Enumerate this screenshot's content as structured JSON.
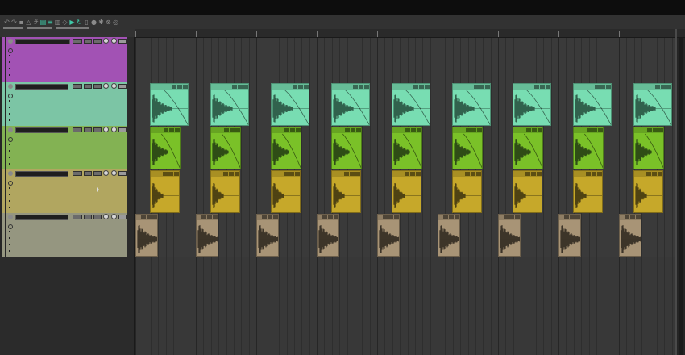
{
  "toolbar": {
    "buttons": [
      {
        "name": "undo-icon",
        "glyph": "↶",
        "hl": false
      },
      {
        "name": "redo-icon",
        "glyph": "↷",
        "hl": false
      },
      {
        "name": "save-icon",
        "glyph": "▪",
        "hl": false
      },
      {
        "name": "metronome-icon",
        "glyph": "△",
        "hl": false
      },
      {
        "name": "grid-icon",
        "glyph": "#",
        "hl": false
      },
      {
        "name": "snap-icon",
        "glyph": "▤",
        "hl": true
      },
      {
        "name": "ripple-icon",
        "glyph": "≡",
        "hl": true
      },
      {
        "name": "lock-icon",
        "glyph": "▥",
        "hl": false
      },
      {
        "name": "envelope-icon",
        "glyph": "◇",
        "hl": false
      },
      {
        "name": "play-icon",
        "glyph": "▶",
        "hl": true
      },
      {
        "name": "loop-icon",
        "glyph": "↻",
        "hl": true
      },
      {
        "name": "marker-icon",
        "glyph": "▯",
        "hl": false
      },
      {
        "name": "record-icon",
        "glyph": "●",
        "hl": false
      },
      {
        "name": "settings-icon",
        "glyph": "✱",
        "hl": false
      },
      {
        "name": "mixer-icon",
        "glyph": "⊗",
        "hl": false
      },
      {
        "name": "globe-icon",
        "glyph": "◎",
        "hl": false
      }
    ]
  },
  "tracks": [
    {
      "id": "parent",
      "name": "",
      "color": "#a252b4",
      "height": 56,
      "is_folder": true
    },
    {
      "id": "t1",
      "name": "",
      "color": "#7cc5a5",
      "height": 54,
      "is_folder": false
    },
    {
      "id": "t2",
      "name": "",
      "color": "#83b253",
      "height": 54,
      "is_folder": false
    },
    {
      "id": "t3",
      "name": "",
      "color": "#b1a660",
      "height": 54,
      "is_folder": false
    },
    {
      "id": "t4",
      "name": "",
      "color": "#959680",
      "height": 54,
      "is_folder": false
    }
  ],
  "ruler": {
    "labels": [
      "",
      "",
      "",
      "",
      "",
      "",
      "",
      "",
      "",
      ""
    ]
  },
  "items": {
    "t1": {
      "color": "#78ddb2",
      "wave": "#31624d",
      "starts": [
        18,
        93,
        168,
        243,
        318,
        393,
        468,
        543,
        618
      ],
      "width": 48,
      "wave_width": 25,
      "fade": true
    },
    "t2": {
      "color": "#7ac128",
      "wave": "#2f4d16",
      "starts": [
        18,
        93,
        168,
        243,
        318,
        393,
        468,
        543,
        618
      ],
      "width": 38,
      "wave_width": 20,
      "fade": true
    },
    "t3": {
      "color": "#c6a82a",
      "wave": "#4f4313",
      "starts": [
        18,
        93,
        168,
        243,
        318,
        393,
        468,
        543,
        618
      ],
      "width": 37,
      "wave_width": 14,
      "fade": false
    },
    "t4": {
      "color": "#a89476",
      "wave": "#3d3529",
      "starts": [
        0,
        75,
        150,
        225,
        300,
        375,
        450,
        525,
        600
      ],
      "width": 28,
      "wave_width": 28,
      "fade": false
    }
  }
}
